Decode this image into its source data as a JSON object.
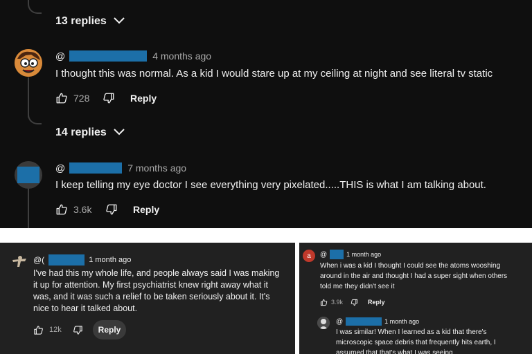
{
  "top_panel": {
    "replies_toggle_1": {
      "label": "13 replies"
    },
    "comment_1": {
      "at": "@",
      "time": "4 months ago",
      "text": "I thought this was normal. As a kid I would stare up at my ceiling at night and see literal tv static",
      "likes": "728",
      "reply_label": "Reply"
    },
    "replies_toggle_2": {
      "label": "14 replies"
    },
    "comment_2": {
      "at": "@",
      "time": "7 months ago",
      "text": "I keep telling my eye doctor I see everything very pixelated.....THIS is what I am talking about.",
      "likes": "3.6k",
      "reply_label": "Reply"
    }
  },
  "bottom_left": {
    "comment": {
      "at": "@(",
      "time": "1 month ago",
      "lines": [
        "I've had this my whole life, and people always said I was making",
        "it up for attention. My first psychiatrist knew right away what it",
        "was, and it was such a relief to be taken seriously about it. It's",
        "nice to hear it talked about."
      ],
      "likes": "12k",
      "reply_label": "Reply"
    }
  },
  "bottom_right": {
    "comment": {
      "avatar_letter": "a",
      "at": "@",
      "time": "1 month ago",
      "lines": [
        "When i was a kid I thought I could see the atoms wooshing",
        "around in the air and thought I had a super sight when others",
        "told me they didn't see it"
      ],
      "likes": "3.9k",
      "reply_label": "Reply"
    },
    "reply": {
      "at": "@",
      "time": "1 month ago",
      "lines": [
        "I was similar! When I learned as a kid that there's",
        "microscopic space debris that frequently hits earth, I",
        "assumed that that's what I was seeing"
      ]
    }
  },
  "colors": {
    "dark_bg": "#0f0f0f",
    "panel_bg": "#212121",
    "redaction": "#1c6fa8",
    "avatar_red": "#c0392b",
    "text": "#f1f1f1",
    "muted": "#aaaaaa"
  },
  "icons": [
    "chevron-down-icon",
    "thumbs-up-icon",
    "thumbs-down-icon"
  ]
}
